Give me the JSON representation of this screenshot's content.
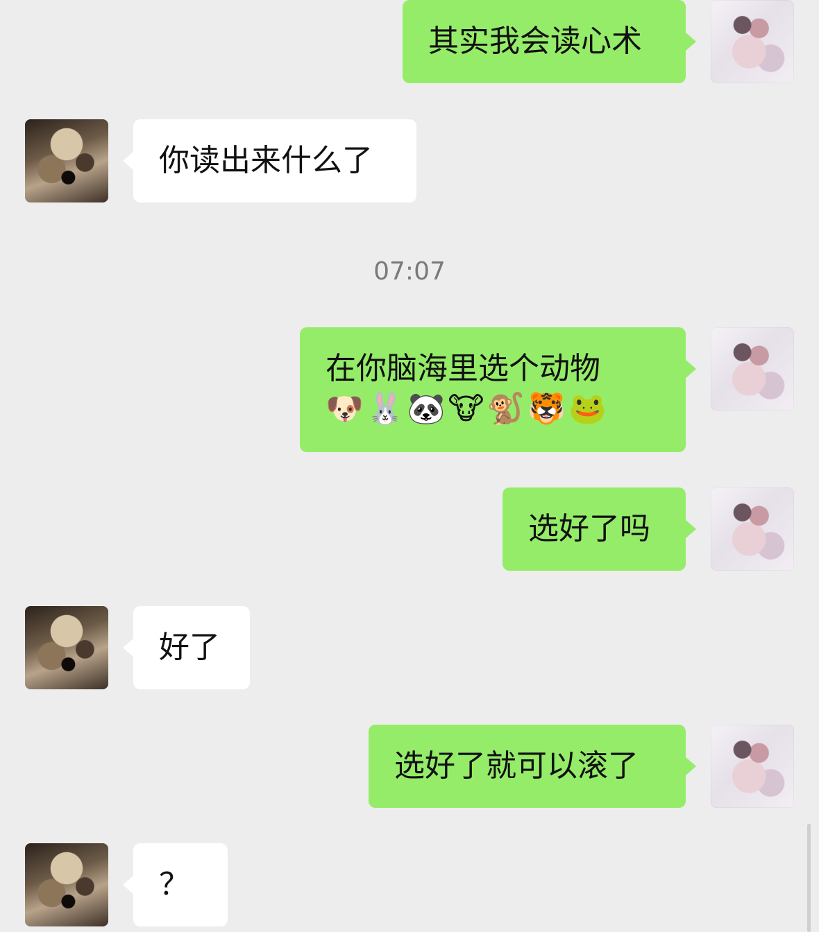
{
  "messages": [
    {
      "sender": "self",
      "text": "其实我会读心术"
    },
    {
      "sender": "other",
      "text": "你读出来什么了"
    },
    {
      "timestamp": "07:07"
    },
    {
      "sender": "self",
      "text": "在你脑海里选个动物",
      "emoji": "🐶🐰🐼🐮🐒🐯🐸"
    },
    {
      "sender": "self",
      "text": "选好了吗"
    },
    {
      "sender": "other",
      "text": "好了"
    },
    {
      "sender": "self",
      "text": "选好了就可以滚了"
    },
    {
      "sender": "other",
      "text": "？"
    }
  ],
  "colors": {
    "background": "#ededed",
    "self_bubble": "#95ec69",
    "other_bubble": "#ffffff",
    "timestamp_text": "#7a7a7a"
  },
  "icons": {
    "self_avatar": "anime-girl-avatar",
    "other_avatar": "artwork-avatar"
  }
}
